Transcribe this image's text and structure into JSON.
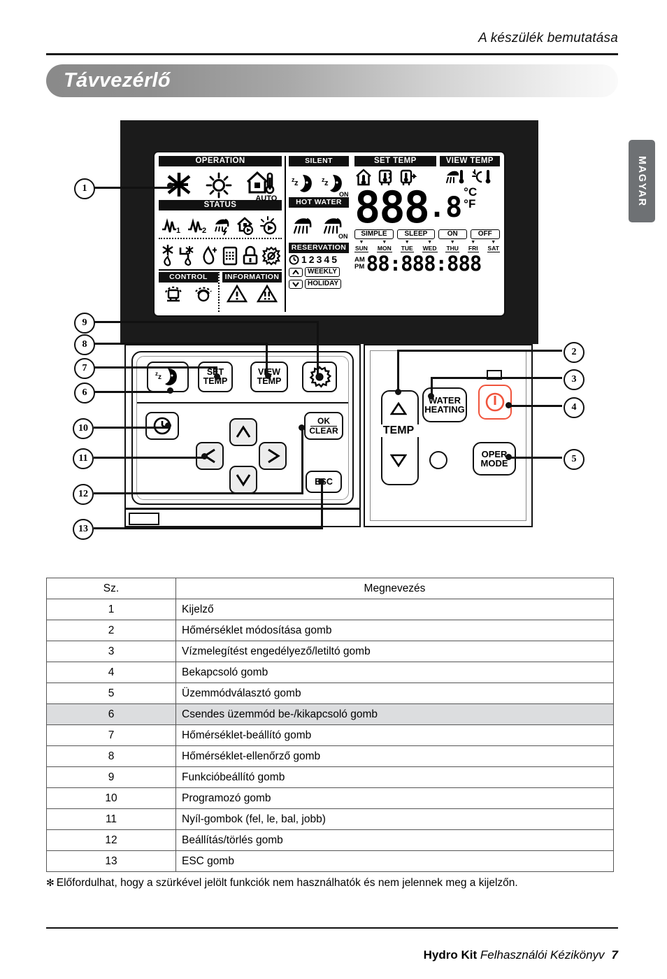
{
  "header": {
    "running_head": "A készülék bemutatása",
    "section_title": "Távvezérlő"
  },
  "language_tab": {
    "label": "MAGYAR"
  },
  "remote": {
    "lcd": {
      "operation": {
        "title": "OPERATION",
        "icons": [
          "cooling-snowflake-icon",
          "heating-sun-icon",
          "auto-house-thermometer-icon"
        ],
        "auto_label": "AUTO"
      },
      "status": {
        "title": "STATUS",
        "icons_row1": [
          "heater-1-icon",
          "heater-2-icon",
          "shower-boost-icon",
          "house-timer-icon",
          "sun-timer-icon"
        ],
        "icons_row2": [
          "defrost-icon",
          "antifreeze-pipe-icon",
          "water-sterilize-icon",
          "calendar-icon",
          "lock-icon",
          "filter-clean-icon"
        ],
        "heater1_label": "1",
        "heater2_label": "2"
      },
      "control": {
        "title": "CONTROL",
        "icons": [
          "central-control-icon",
          "remote-sensor-icon"
        ]
      },
      "information": {
        "title": "INFORMATION",
        "icons": [
          "warning-1-icon",
          "warning-2-icon"
        ]
      },
      "silent": {
        "title": "SILENT",
        "icons": [
          "moon-silent-icon",
          "moon-silent-on-icon"
        ],
        "on_label": "ON"
      },
      "hot_water": {
        "title": "HOT WATER",
        "icons": [
          "shower-icon",
          "shower-on-icon"
        ],
        "on_label": "ON"
      },
      "set_temp": {
        "title": "SET TEMP",
        "icons": [
          "room-temp-icon",
          "water-in-temp-icon",
          "water-out-temp-icon"
        ]
      },
      "view_temp": {
        "title": "VIEW TEMP",
        "icons": [
          "shower-temp-icon",
          "solar-temp-icon"
        ]
      },
      "temperature": {
        "digits": "888",
        "decimal": ".8",
        "unit_c": "°C",
        "unit_f": "°F"
      },
      "reservation": {
        "title": "RESERVATION",
        "numbers": [
          "1",
          "2",
          "3",
          "4",
          "5"
        ],
        "clock_icon": "clock-icon",
        "up_icon": "chevron-up-icon",
        "down_icon": "chevron-down-icon",
        "weekly_label": "WEEKLY",
        "holiday_label": "HOLIDAY"
      },
      "modes": [
        "SIMPLE",
        "SLEEP",
        "ON",
        "OFF"
      ],
      "weekdays": [
        "SUN",
        "MON",
        "TUE",
        "WED",
        "THU",
        "FRI",
        "SAT"
      ],
      "clock": {
        "am_label": "AM",
        "pm_label": "PM",
        "digits": "88:888:888"
      }
    },
    "buttons": {
      "silent": {
        "label": "",
        "icon": "moon-sleep-icon"
      },
      "set_temp": {
        "line1": "SET",
        "line2": "TEMP"
      },
      "view_temp": {
        "line1": "VIEW",
        "line2": "TEMP"
      },
      "function": {
        "label": "",
        "icon": "gear-icon"
      },
      "schedule": {
        "label": "",
        "icon": "clock-icon"
      },
      "arrow_up": {
        "label": "",
        "icon": "arrow-up-icon"
      },
      "arrow_down": {
        "label": "",
        "icon": "arrow-down-icon"
      },
      "arrow_left": {
        "label": "",
        "icon": "arrow-left-icon"
      },
      "arrow_right": {
        "label": "",
        "icon": "arrow-right-icon"
      },
      "ok_clear": {
        "line1": "OK",
        "line2": "CLEAR"
      },
      "esc": {
        "label": "ESC"
      },
      "temp_label": "TEMP",
      "temp_up": {
        "icon": "triangle-up-icon"
      },
      "temp_down": {
        "icon": "triangle-down-icon"
      },
      "water_heating": {
        "line1": "WATER",
        "line2": "HEATING"
      },
      "power": {
        "icon": "power-icon",
        "accent": "#f0543c"
      },
      "oper_mode": {
        "line1": "OPER",
        "line2": "MODE"
      }
    },
    "callouts": [
      "1",
      "2",
      "3",
      "4",
      "5",
      "6",
      "7",
      "8",
      "9",
      "10",
      "11",
      "12",
      "13"
    ]
  },
  "table": {
    "headers": [
      "Sz.",
      "Megnevezés"
    ],
    "rows": [
      {
        "no": "1",
        "name": "Kijelző",
        "shaded": false
      },
      {
        "no": "2",
        "name": "Hőmérséklet módosítása gomb",
        "shaded": false
      },
      {
        "no": "3",
        "name": "Vízmelegítést engedélyező/letiltó gomb",
        "shaded": false
      },
      {
        "no": "4",
        "name": "Bekapcsoló gomb",
        "shaded": false
      },
      {
        "no": "5",
        "name": "Üzemmódválasztó gomb",
        "shaded": false
      },
      {
        "no": "6",
        "name": "Csendes üzemmód be-/kikapcsoló gomb",
        "shaded": true
      },
      {
        "no": "7",
        "name": "Hőmérséklet-beállító gomb",
        "shaded": false
      },
      {
        "no": "8",
        "name": "Hőmérséklet-ellenőrző gomb",
        "shaded": false
      },
      {
        "no": "9",
        "name": "Funkcióbeállító gomb",
        "shaded": false
      },
      {
        "no": "10",
        "name": "Programozó gomb",
        "shaded": false
      },
      {
        "no": "11",
        "name": "Nyíl-gombok (fel, le, bal, jobb)",
        "shaded": false
      },
      {
        "no": "12",
        "name": "Beállítás/törlés gomb",
        "shaded": false
      },
      {
        "no": "13",
        "name": "ESC gomb",
        "shaded": false
      }
    ]
  },
  "footnote": {
    "marker": "✻",
    "text": "Előfordulhat, hogy a szürkével jelölt funkciók nem használhatók és nem jelennek meg a kijelzőn."
  },
  "footer": {
    "brand": "Hydro Kit",
    "manual": "Felhasználói Kézikönyv",
    "page": "7"
  }
}
